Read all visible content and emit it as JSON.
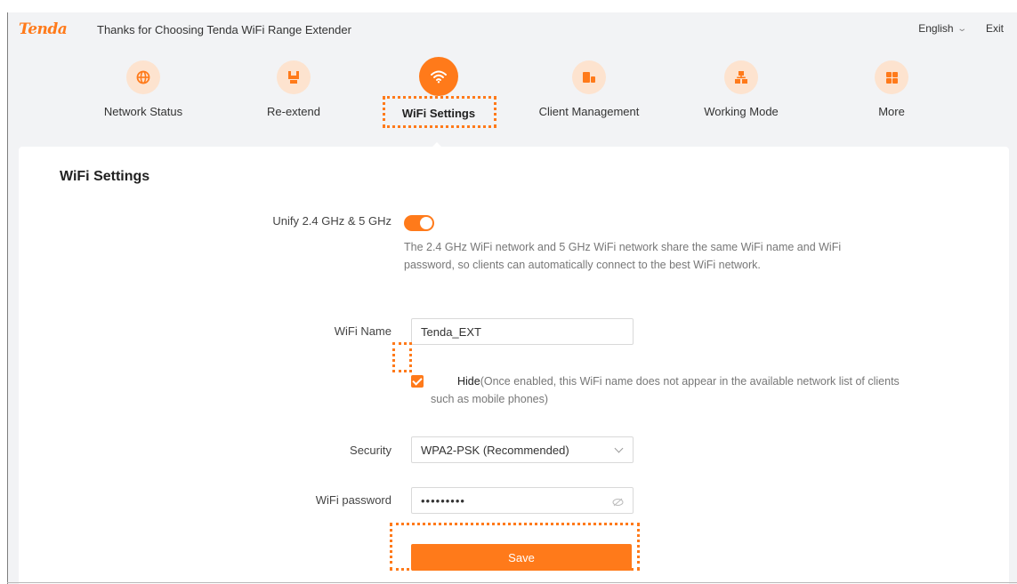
{
  "header": {
    "logo": "Tenda",
    "title": "Thanks for Choosing Tenda WiFi Range Extender",
    "language": "English",
    "exit": "Exit"
  },
  "nav": [
    {
      "label": "Network Status",
      "icon": "globe-icon"
    },
    {
      "label": "Re-extend",
      "icon": "extender-icon"
    },
    {
      "label": "WiFi Settings",
      "icon": "wifi-icon",
      "active": true
    },
    {
      "label": "Client Management",
      "icon": "devices-icon"
    },
    {
      "label": "Working Mode",
      "icon": "network-mode-icon"
    },
    {
      "label": "More",
      "icon": "grid-icon"
    }
  ],
  "panel": {
    "title": "WiFi Settings",
    "unify_label": "Unify 2.4 GHz & 5 GHz",
    "unify_enabled": true,
    "unify_desc": "The 2.4 GHz WiFi network and 5 GHz WiFi network share the same WiFi name and WiFi password, so clients can automatically connect to the best WiFi network.",
    "wifi_name_label": "WiFi Name",
    "wifi_name_value": "Tenda_EXT",
    "hide_checked": true,
    "hide_label": "Hide",
    "hide_desc": "(Once enabled, this WiFi name does not appear in the available network list of clients such as mobile phones)",
    "security_label": "Security",
    "security_value": "WPA2-PSK (Recommended)",
    "password_label": "WiFi password",
    "password_value": "•••••••••",
    "save_label": "Save"
  },
  "colors": {
    "accent": "#ff7a1a",
    "accent_light": "#fde3cf",
    "background": "#f2f3f5"
  }
}
